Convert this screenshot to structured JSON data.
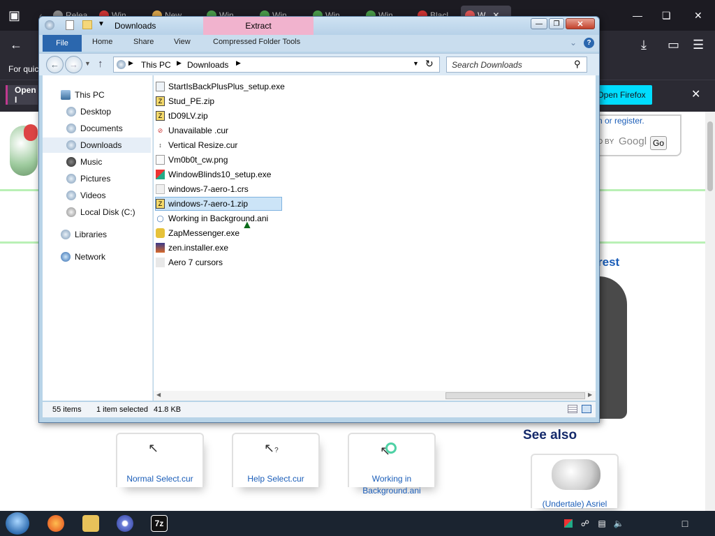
{
  "browser": {
    "tabs": [
      "Relea",
      "Win",
      "New",
      "Win",
      "Win",
      "Win",
      "Win",
      "Blacl",
      "W"
    ],
    "bookmarks_text": "For quic",
    "notification": {
      "open_label": "Open I",
      "open_firefox_label": "Open Firefox"
    }
  },
  "webpage": {
    "login_text": "n or register.",
    "google_text": "D BY",
    "google_brand": "Googl",
    "go_label": "Go",
    "heading_fragment": "rest",
    "see_also": "See also",
    "cards": [
      {
        "label": "Normal Select.cur"
      },
      {
        "label": "Help Select.cur"
      },
      {
        "label_line1": "Working in",
        "label_line2": "Background.ani"
      },
      {
        "label": "(Undertale) Asriel"
      }
    ]
  },
  "explorer": {
    "title": "Downloads",
    "extract_tab": "Extract",
    "ribbon": {
      "file": "File",
      "home": "Home",
      "share": "Share",
      "view": "View",
      "compressed_tools": "Compressed Folder Tools"
    },
    "address": {
      "this_pc": "This PC",
      "downloads": "Downloads"
    },
    "search_placeholder": "Search Downloads",
    "nav": {
      "this_pc": "This PC",
      "desktop": "Desktop",
      "documents": "Documents",
      "downloads": "Downloads",
      "music": "Music",
      "pictures": "Pictures",
      "videos": "Videos",
      "local_disk": "Local Disk (C:)",
      "libraries": "Libraries",
      "network": "Network"
    },
    "files": [
      "StartIsBackPlusPlus_setup.exe",
      "Stud_PE.zip",
      "tD09LV.zip",
      "Unavailable .cur",
      "Vertical Resize.cur",
      "Vm0b0t_cw.png",
      "WindowBlinds10_setup.exe",
      "windows-7-aero-1.crs",
      "windows-7-aero-1.zip",
      "Working in Background.ani",
      "ZapMessenger.exe",
      "zen.installer.exe",
      "Aero 7 cursors"
    ],
    "status": {
      "items": "55 items",
      "selected": "1 item selected",
      "size": "41.8 KB"
    }
  },
  "taskbar": {
    "sevenzip_label": "7z"
  }
}
